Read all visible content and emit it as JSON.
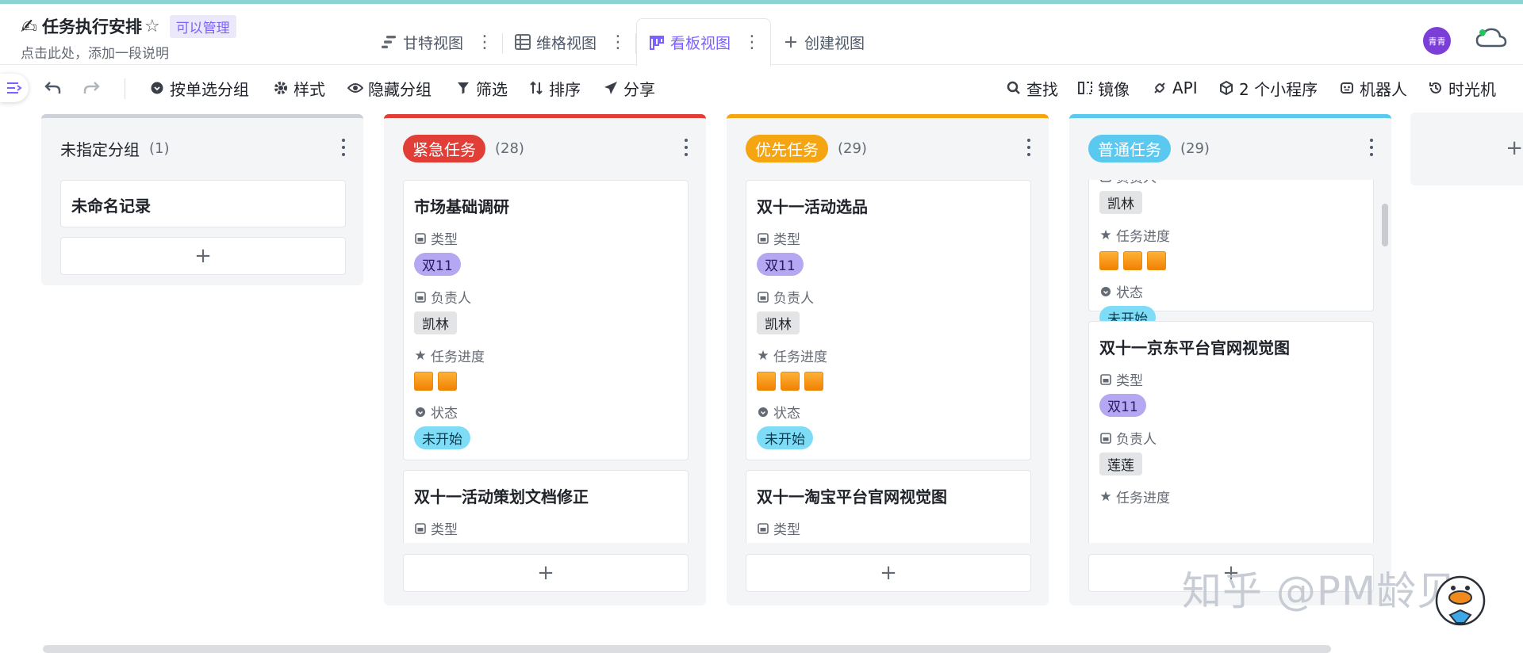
{
  "header": {
    "emoji": "✍",
    "title": "任务执行安排",
    "star": "☆",
    "permission": "可以管理",
    "description": "点击此处，添加一段说明",
    "avatar_text": "青青"
  },
  "views": [
    {
      "label": "甘特视图",
      "icon": "gantt-icon"
    },
    {
      "label": "维格视图",
      "icon": "grid-icon"
    },
    {
      "label": "看板视图",
      "icon": "kanban-icon",
      "active": true
    },
    {
      "label": "创建视图",
      "icon": "plus-icon"
    }
  ],
  "toolbar": {
    "group_by": "按单选分组",
    "style": "样式",
    "hide_groups": "隐藏分组",
    "filter": "筛选",
    "sort": "排序",
    "share": "分享",
    "find": "查找",
    "mirror": "镜像",
    "api": "API",
    "widgets": "2 个小程序",
    "robot": "机器人",
    "time_machine": "时光机"
  },
  "fields": {
    "type": "类型",
    "owner": "负责人",
    "progress": "任务进度",
    "status": "状态"
  },
  "columns": [
    {
      "name": "未指定分组",
      "count": "(1)",
      "color": "#c9cbd3",
      "cards": [
        {
          "title": "未命名记录"
        }
      ]
    },
    {
      "name": "紧急任务",
      "count": "(28)",
      "color": "#e03e36",
      "cards": [
        {
          "title": "市场基础调研",
          "type": "双11",
          "owner": "凯林",
          "progress": 2,
          "status": "未开始"
        },
        {
          "title": "双十一活动策划文档修正"
        }
      ]
    },
    {
      "name": "优先任务",
      "count": "(29)",
      "color": "#f5a412",
      "cards": [
        {
          "title": "双十一活动选品",
          "type": "双11",
          "owner": "凯林",
          "progress": 3,
          "status": "未开始"
        },
        {
          "title": "双十一淘宝平台官网视觉图"
        }
      ]
    },
    {
      "name": "普通任务",
      "count": "(29)",
      "color": "#5bc8f0",
      "cards": [
        {
          "owner": "凯林",
          "progress": 3,
          "status": "未开始"
        },
        {
          "title": "双十一京东平台官网视觉图",
          "type": "双11",
          "owner": "莲莲"
        }
      ]
    }
  ],
  "add_symbol": "+",
  "watermark": "知乎 @PM龄见"
}
